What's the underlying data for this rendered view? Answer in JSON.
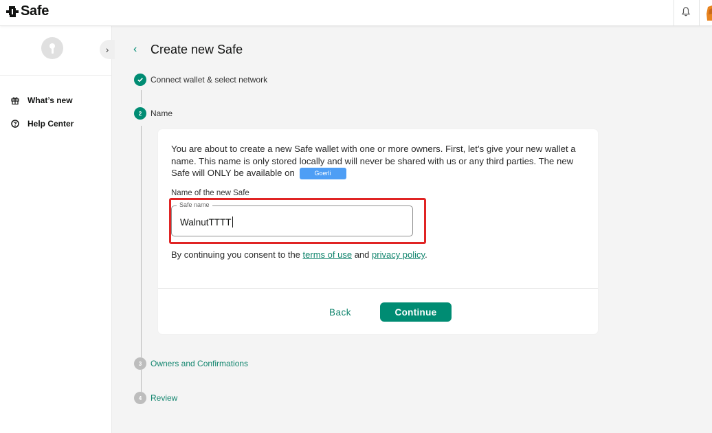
{
  "header": {
    "logo_text": "Safe",
    "icons": [
      "safe-logo-icon",
      "bell-icon"
    ]
  },
  "sidebar": {
    "items": [
      {
        "label": "What’s new",
        "icon": "gift-icon"
      },
      {
        "label": "Help Center",
        "icon": "help-circle-icon"
      }
    ]
  },
  "main": {
    "title": "Create new Safe",
    "steps": [
      {
        "number": "",
        "label": "Connect wallet & select network",
        "state": "done"
      },
      {
        "number": "2",
        "label": "Name",
        "state": "active"
      },
      {
        "number": "3",
        "label": "Owners and Confirmations",
        "state": "pending"
      },
      {
        "number": "4",
        "label": "Review",
        "state": "pending"
      }
    ],
    "card": {
      "description": "You are about to create a new Safe wallet with one or more owners. First, let’s give your new wallet a name. This name is only stored locally and will never be shared with us or any third parties. The new Safe will ONLY be available on",
      "network_chip": "Goerli",
      "field_label": "Name of the new Safe",
      "input_legend": "Safe name",
      "input_value": "WalnutTTTT",
      "consent_prefix": "By continuing you consent to the",
      "terms_link": "terms of use",
      "consent_and": "and",
      "privacy_link": "privacy policy",
      "consent_suffix": ".",
      "back_label": "Back",
      "continue_label": "Continue"
    }
  },
  "colors": {
    "accent": "#008c73",
    "link": "#12856e",
    "highlight": "#e02424",
    "chip": "#4e9ef5"
  }
}
